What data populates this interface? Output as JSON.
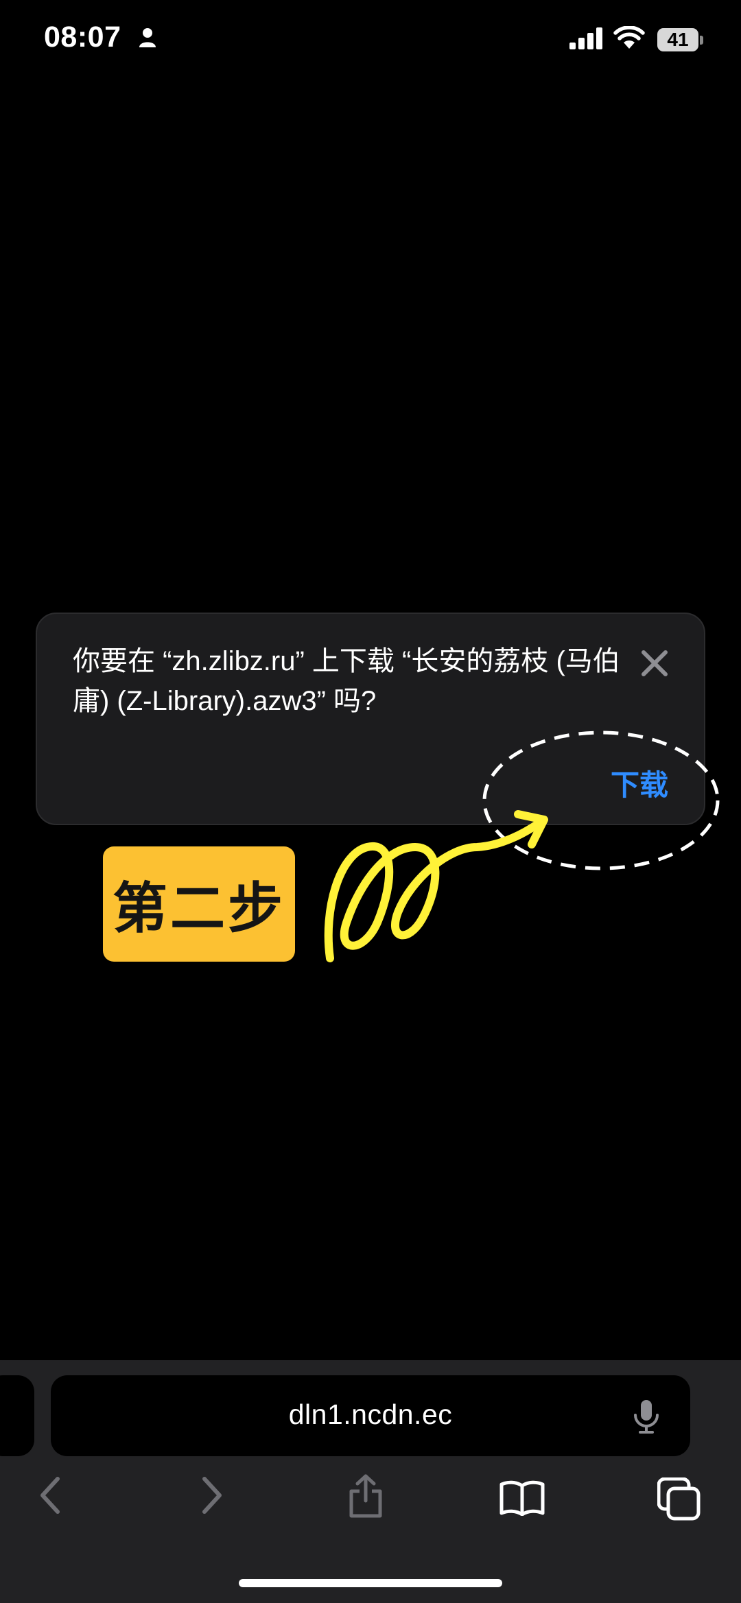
{
  "status_bar": {
    "time": "08:07",
    "battery_level": "41"
  },
  "dialog": {
    "message": "你要在 “zh.zlibz.ru” 上下载 “长安的荔枝 (马伯庸) (Z-Library).azw3” 吗?",
    "download_label": "下载",
    "accent_color": "#2f8cff"
  },
  "annotation": {
    "step_label": "第二步",
    "badge_color": "#fcc132",
    "arrow_color": "#fff238"
  },
  "toolbar": {
    "address": "dln1.ncdn.ec",
    "buttons": [
      "back-icon",
      "forward-icon",
      "share-icon",
      "bookmarks-icon",
      "tabs-icon"
    ]
  }
}
